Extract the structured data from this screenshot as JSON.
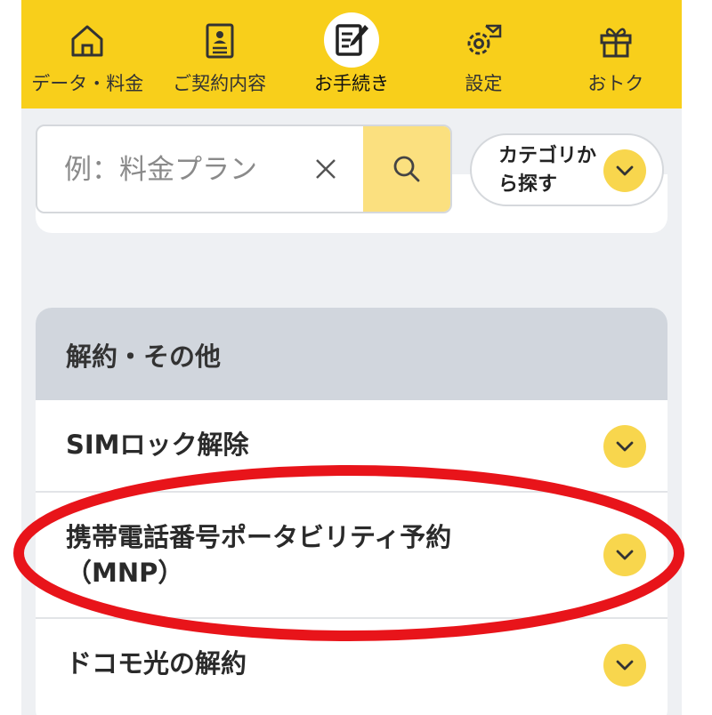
{
  "nav": {
    "items": [
      {
        "label": "データ・料金",
        "icon": "home-icon",
        "active": false
      },
      {
        "label": "ご契約内容",
        "icon": "contract-icon",
        "active": false
      },
      {
        "label": "お手続き",
        "icon": "procedure-edit-icon",
        "active": true
      },
      {
        "label": "設定",
        "icon": "settings-gear-icon",
        "active": false
      },
      {
        "label": "おトク",
        "icon": "gift-icon",
        "active": false
      }
    ]
  },
  "search": {
    "placeholder": "例：料金プラン",
    "value": ""
  },
  "category_button": {
    "label": "カテゴリから探す"
  },
  "section": {
    "title": "解約・その他",
    "items": [
      {
        "label": "SIMロック解除"
      },
      {
        "label": "携帯電話番号ポータビリティ予約（MNP）"
      },
      {
        "label": "ドコモ光の解約"
      }
    ]
  },
  "colors": {
    "brand_yellow": "#f8cf1b",
    "chevron_yellow": "#f8d64d",
    "search_button": "#fbe07f",
    "section_header": "#d1d6dd",
    "annotation_red": "#e8141a"
  }
}
